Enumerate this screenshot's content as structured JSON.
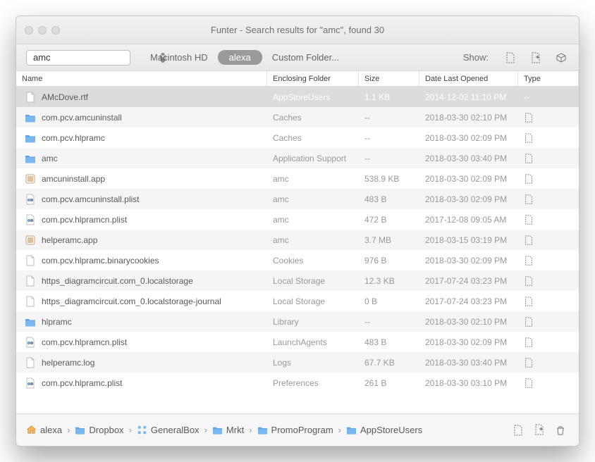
{
  "title": "Funter - Search results for \"amc\", found 30",
  "search": {
    "value": "amc"
  },
  "scope": {
    "mac": "Macintosh HD",
    "home": "alexa",
    "custom": "Custom Folder..."
  },
  "show_label": "Show:",
  "columns": {
    "name": "Name",
    "folder": "Enclosing Folder",
    "size": "Size",
    "date": "Date Last Opened",
    "type": "Type"
  },
  "rows": [
    {
      "icon": "file",
      "name": "AMcDove.rtf",
      "folder": "AppStoreUsers",
      "size": "1.1 KB",
      "date": "2014-12-02 11:10 PM",
      "type": "--",
      "selected": true
    },
    {
      "icon": "folder",
      "name": "com.pcv.amcuninstall",
      "folder": "Caches",
      "size": "--",
      "date": "2018-03-30 02:10 PM",
      "type": "show"
    },
    {
      "icon": "folder",
      "name": "com.pcv.hlpramc",
      "folder": "Caches",
      "size": "--",
      "date": "2018-03-30 02:09 PM",
      "type": "show"
    },
    {
      "icon": "folder",
      "name": "amc",
      "folder": "Application Support",
      "size": "--",
      "date": "2018-03-30 03:40 PM",
      "type": "show"
    },
    {
      "icon": "app",
      "name": "amcuninstall.app",
      "folder": "amc",
      "size": "538.9 KB",
      "date": "2018-03-30 02:09 PM",
      "type": "show"
    },
    {
      "icon": "plist",
      "name": "com.pcv.amcuninstall.plist",
      "folder": "amc",
      "size": "483 B",
      "date": "2018-03-30 02:09 PM",
      "type": "show"
    },
    {
      "icon": "plist",
      "name": "com.pcv.hlpramcn.plist",
      "folder": "amc",
      "size": "472 B",
      "date": "2017-12-08 09:05 AM",
      "type": "show"
    },
    {
      "icon": "app",
      "name": "helperamc.app",
      "folder": "amc",
      "size": "3.7 MB",
      "date": "2018-03-15 03:19 PM",
      "type": "show"
    },
    {
      "icon": "file",
      "name": "com.pcv.hlpramc.binarycookies",
      "folder": "Cookies",
      "size": "976 B",
      "date": "2018-03-30 02:09 PM",
      "type": "show"
    },
    {
      "icon": "file",
      "name": "https_diagramcircuit.com_0.localstorage",
      "folder": "Local Storage",
      "size": "12.3 KB",
      "date": "2017-07-24 03:23 PM",
      "type": "show"
    },
    {
      "icon": "file",
      "name": "https_diagramcircuit.com_0.localstorage-journal",
      "folder": "Local Storage",
      "size": "0 B",
      "date": "2017-07-24 03:23 PM",
      "type": "show"
    },
    {
      "icon": "folder",
      "name": "hlpramc",
      "folder": "Library",
      "size": "--",
      "date": "2018-03-30 02:10 PM",
      "type": "show"
    },
    {
      "icon": "plist",
      "name": "com.pcv.hlpramcn.plist",
      "folder": "LaunchAgents",
      "size": "483 B",
      "date": "2018-03-30 02:09 PM",
      "type": "show"
    },
    {
      "icon": "file",
      "name": "helperamc.log",
      "folder": "Logs",
      "size": "67.7 KB",
      "date": "2018-03-30 03:40 PM",
      "type": "show"
    },
    {
      "icon": "plist",
      "name": "com.pcv.hlpramc.plist",
      "folder": "Preferences",
      "size": "261 B",
      "date": "2018-03-30 03:10 PM",
      "type": "show"
    }
  ],
  "path": [
    "alexa",
    "Dropbox",
    "GeneralBox",
    "Mrkt",
    "PromoProgram",
    "AppStoreUsers"
  ],
  "path_icons": [
    "home",
    "folder",
    "grid",
    "folder",
    "folder",
    "folder"
  ]
}
